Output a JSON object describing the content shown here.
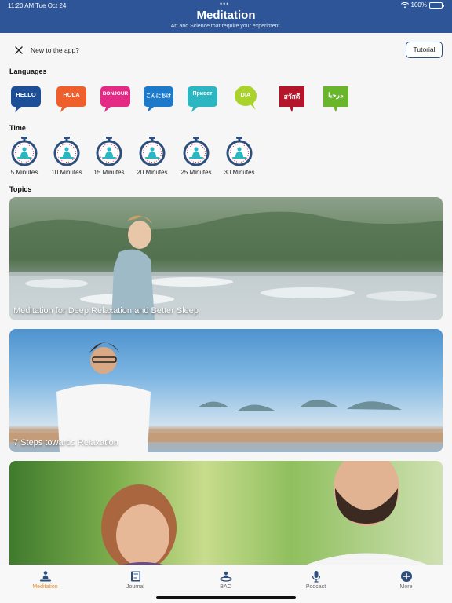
{
  "status": {
    "time": "11:20 AM",
    "date": "Tue Oct 24",
    "battery": "100%"
  },
  "header": {
    "title": "Meditation",
    "subtitle": "Art and Science that require your experiment."
  },
  "notice": {
    "text": "New to the app?",
    "tutorial_label": "Tutorial"
  },
  "languages": {
    "heading": "Languages",
    "items": [
      {
        "label": "HELLO",
        "color": "#1d4f96"
      },
      {
        "label": "HOLA",
        "color": "#ef5f2b"
      },
      {
        "label": "BONJOUR",
        "color": "#e52a86"
      },
      {
        "label": "こんにちは",
        "color": "#1d79c9"
      },
      {
        "label": "Привет",
        "color": "#2bb6c2"
      },
      {
        "label": "DIA",
        "color": "#a9d22a"
      },
      {
        "label": "สวัสดี",
        "color": "#b5152b"
      },
      {
        "label": "مرحبا",
        "color": "#69b52c"
      }
    ]
  },
  "time": {
    "heading": "Time",
    "items": [
      {
        "label": "5 Minutes"
      },
      {
        "label": "10 Minutes"
      },
      {
        "label": "15 Minutes"
      },
      {
        "label": "20 Minutes"
      },
      {
        "label": "25 Minutes"
      },
      {
        "label": "30 Minutes"
      }
    ]
  },
  "topics": {
    "heading": "Topics",
    "items": [
      {
        "title": "Meditation for Deep Relaxation and Better Sleep"
      },
      {
        "title": "7 Steps towards Relaxation"
      },
      {
        "title": ""
      }
    ]
  },
  "tabs": [
    {
      "label": "Meditation",
      "icon": "meditation-icon",
      "active": true
    },
    {
      "label": "Journal",
      "icon": "journal-icon",
      "active": false
    },
    {
      "label": "BAC",
      "icon": "bac-icon",
      "active": false
    },
    {
      "label": "Podcast",
      "icon": "microphone-icon",
      "active": false
    },
    {
      "label": "More",
      "icon": "plus-circle-icon",
      "active": false
    }
  ],
  "colors": {
    "header": "#2d5597",
    "accent": "#e8902d",
    "timer_ring": "#2d4f7e",
    "timer_figure": "#2bb6c2"
  }
}
